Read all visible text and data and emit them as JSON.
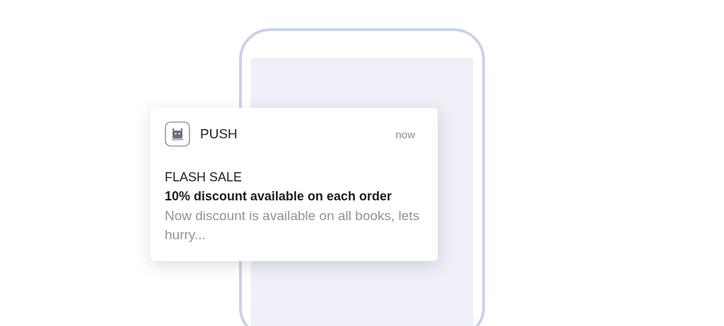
{
  "notification": {
    "app_name": "PUSH",
    "time": "now",
    "title": "FLASH SALE",
    "headline": "10% discount available on each order",
    "body": "Now discount is available on all books, lets hurry..."
  }
}
